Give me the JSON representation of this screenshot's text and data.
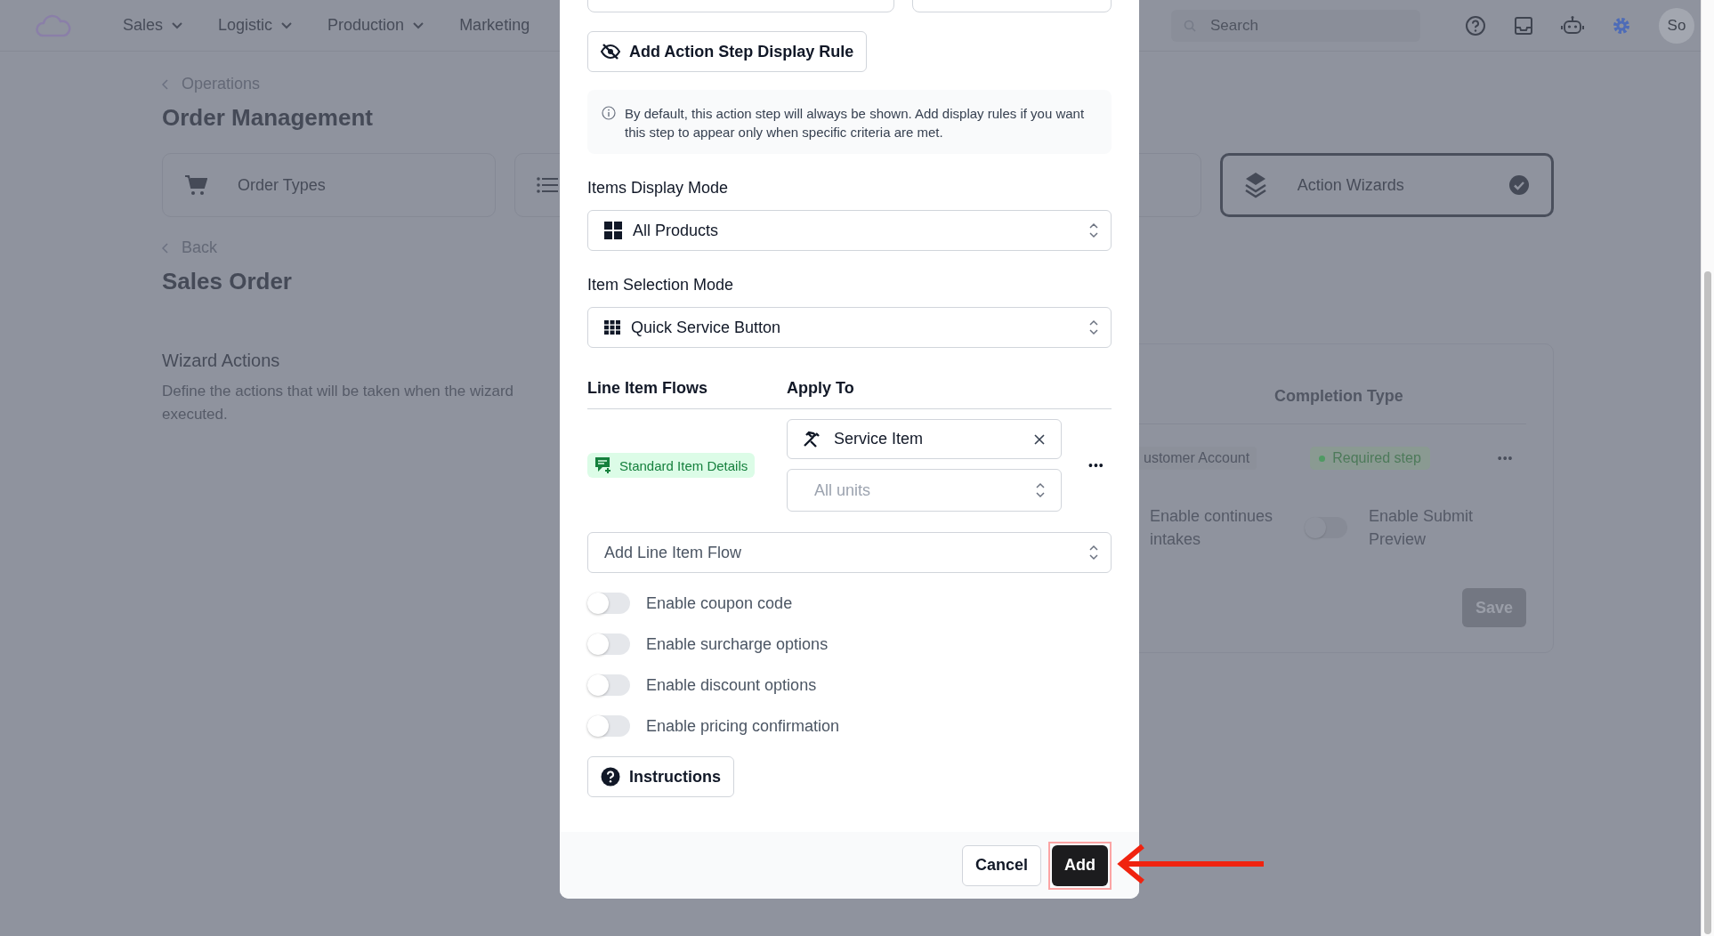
{
  "nav": {
    "items": [
      {
        "label": "Sales",
        "dropdown": true
      },
      {
        "label": "Logistic",
        "dropdown": true
      },
      {
        "label": "Production",
        "dropdown": true
      },
      {
        "label": "Marketing",
        "dropdown": false
      }
    ],
    "search": {
      "placeholder": "Search"
    },
    "avatar": "So"
  },
  "breadcrumb": "Operations",
  "page_title": "Order Management",
  "cards": [
    {
      "kind": "cart",
      "label": "Order Types",
      "selected": false
    },
    {
      "kind": "list",
      "selected": false
    },
    {
      "kind": "blank",
      "selected": false
    },
    {
      "kind": "layers",
      "label": "Action Wizards",
      "selected": true
    }
  ],
  "back": "Back",
  "section_title": "Sales Order",
  "wizard": {
    "title": "Wizard Actions",
    "description": "Define the actions that will be taken when the wizard",
    "description_2": "executed.",
    "column": "Completion Type",
    "row": {
      "account": "ustomer Account",
      "completion": "Required step",
      "more": "•••"
    },
    "toggles": [
      {
        "label": "Enable continues intakes",
        "kind": "text"
      },
      {
        "label": "Enable Submit Preview",
        "on": false,
        "kind": "switch"
      }
    ],
    "save": "Save"
  },
  "modal": {
    "rule_button": "Add Action Step Display Rule",
    "info": "By default, this action step will always be shown. Add display rules if you want this step to appear only when specific criteria are met.",
    "fields": [
      {
        "label": "Items Display Mode",
        "value": "All Products",
        "kind": "grid4"
      },
      {
        "label": "Item Selection Mode",
        "value": "Quick Service Button",
        "kind": "grid9"
      }
    ],
    "flows": {
      "col1": "Line Item Flows",
      "col2": "Apply To",
      "badge": "Standard Item Details",
      "apply": "Service Item",
      "units_placeholder": "All units",
      "more": "•••"
    },
    "add_flow": {
      "placeholder": "Add Line Item Flow"
    },
    "toggles": [
      {
        "label": "Enable coupon code",
        "on": false
      },
      {
        "label": "Enable surcharge options",
        "on": false
      },
      {
        "label": "Enable discount options",
        "on": false
      },
      {
        "label": "Enable pricing confirmation",
        "on": false
      }
    ],
    "instructions": "Instructions",
    "cancel": "Cancel",
    "add": "Add"
  }
}
